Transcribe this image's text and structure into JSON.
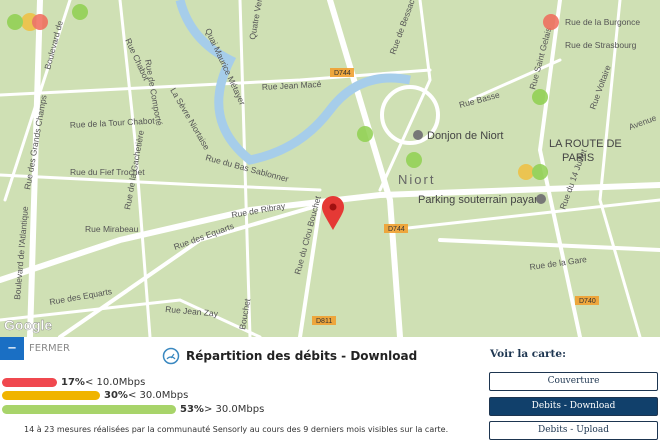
{
  "map": {
    "labels": {
      "blvd_atlantique": "Boulevard de l'Atlantique",
      "blvd_top": "Boulevard de",
      "tour_chabot": "Rue de la Tour Chabot",
      "grands_champs": "Rue des Grands Champs",
      "fief_trochet": "Rue du Fief Trochet",
      "gachetiere": "Rue de la Gachetière",
      "mirabeau": "Rue Mirabeau",
      "equarts": "Rue des Equarts",
      "ribray": "Rue de Ribray",
      "bas_sablonner": "Rue du Bas Sablonner",
      "jean_mace": "Rue Jean Macé",
      "sevre": "La Sèvre Niortaise",
      "quai": "Quai Maurice Métayer",
      "chabot": "Rue Chabot",
      "comporte": "Rue de Comporté",
      "quatre_vents": "Quatre Vents",
      "clou_bouchet": "Rue du Clou Bouchet",
      "jean_zay": "Rue Jean Zay",
      "bouchet": "Bouchet",
      "bessac": "Rue de Bessac",
      "basse": "Rue Basse",
      "burgonce": "Rue de la Burgonce",
      "strasbourg": "Rue de Strasbourg",
      "voltaire": "Rue Voltaire",
      "saint_gelais": "Rue Saint Gelais",
      "quatorze_juillet": "Rue du 14 Juillet",
      "gare": "Rue de la Gare",
      "avenue": "Avenue"
    },
    "pois": {
      "donjon": "Donjon de Niort",
      "city": "Niort",
      "parking": "Parking souterrain payant",
      "route_paris": "LA ROUTE DE",
      "route_paris2": "PARIS"
    },
    "shields": [
      "D744",
      "D744",
      "D811",
      "D740"
    ],
    "google_logo": "Google",
    "marker_colors": {
      "low": "#f06a5a",
      "mid": "#f0c040",
      "high": "#8fd050"
    },
    "pin_color": "#e53935"
  },
  "panel": {
    "close_label": "FERMER",
    "close_icon": "minus-icon",
    "title": "Répartition des débits - Download",
    "title_icon": "speedometer-icon",
    "bars": [
      {
        "percent": 17,
        "pct_label": "17%",
        "range": " < 10.0Mbps",
        "color": "#f0484f"
      },
      {
        "percent": 30,
        "pct_label": "30%",
        "range": " < 30.0Mbps",
        "color": "#f0b400"
      },
      {
        "percent": 53,
        "pct_label": "53%",
        "range": " > 30.0Mbps",
        "color": "#a8d46a"
      }
    ],
    "note": "14 à 23 mesures réalisées par la communauté Sensorly au cours des 9 derniers mois visibles sur la carte."
  },
  "sidebar": {
    "title": "Voir la carte:",
    "buttons": [
      {
        "label": "Couverture",
        "active": false
      },
      {
        "label": "Debits - Download",
        "active": true
      },
      {
        "label": "Debits - Upload",
        "active": false
      }
    ]
  }
}
